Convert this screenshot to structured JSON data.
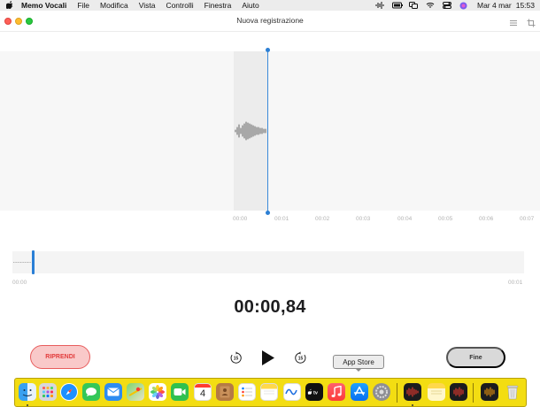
{
  "menubar": {
    "app_name": "Memo Vocali",
    "items": [
      "File",
      "Modifica",
      "Vista",
      "Controlli",
      "Finestra",
      "Aiuto"
    ],
    "clock_date": "Mar 4 mar",
    "clock_time": "15:53"
  },
  "window": {
    "title": "Nuova registrazione"
  },
  "timeline": {
    "ticks": [
      "00:00",
      "00:01",
      "00:02",
      "00:03",
      "00:04",
      "00:05",
      "00:06",
      "00:07"
    ]
  },
  "overview": {
    "start_label": "00:00",
    "end_label": "00:01"
  },
  "player": {
    "elapsed": "00:00,84",
    "resume_label": "RIPRENDI",
    "done_label": "Fine",
    "skip_back_seconds": "15",
    "skip_forward_seconds": "15"
  },
  "dock": {
    "tooltip": "App Store",
    "calendar_day": "4",
    "apps": [
      "finder",
      "launchpad",
      "safari",
      "messages",
      "mail",
      "maps",
      "photos",
      "facetime",
      "calendar",
      "contacts",
      "reminders",
      "notes",
      "freeform",
      "tv",
      "music",
      "app-store",
      "system-settings",
      "voice-memos",
      "notes-2",
      "voice-memos-2",
      "voice-memos-3",
      "trash"
    ]
  },
  "colors": {
    "accent_blue": "#2c7fd4",
    "resume_red": "#e23c3c",
    "dock_yellow": "#f3dd12"
  }
}
